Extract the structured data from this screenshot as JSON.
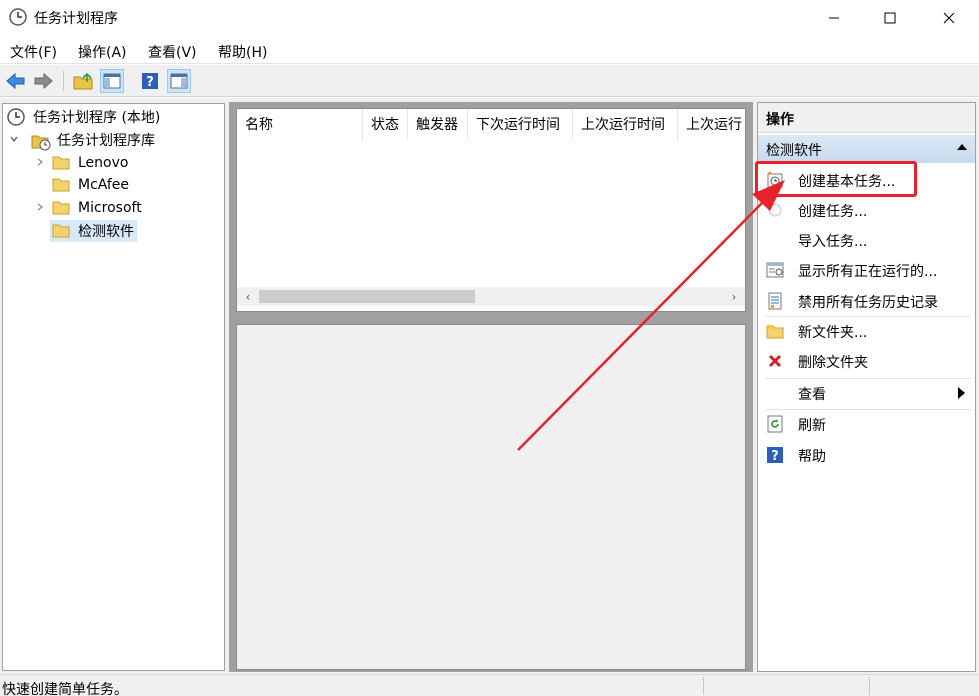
{
  "window": {
    "title": "任务计划程序",
    "controls": {
      "minimize": "minimize",
      "maximize": "maximize",
      "close": "close"
    }
  },
  "menu": {
    "items": [
      "文件(F)",
      "操作(A)",
      "查看(V)",
      "帮助(H)"
    ]
  },
  "toolbar": {
    "buttons": [
      "back-icon",
      "forward-icon",
      "folder-up-icon",
      "show-hide-console-tree-icon",
      "help-icon",
      "show-hide-action-pane-icon"
    ]
  },
  "tree": {
    "root": "任务计划程序 (本地)",
    "library": "任务计划程序库",
    "folders": [
      {
        "label": "Lenovo",
        "expandable": true,
        "selected": false
      },
      {
        "label": "McAfee",
        "expandable": false,
        "selected": false
      },
      {
        "label": "Microsoft",
        "expandable": true,
        "selected": false
      },
      {
        "label": "检测软件",
        "expandable": false,
        "selected": true
      }
    ]
  },
  "task_list": {
    "columns": [
      "名称",
      "状态",
      "触发器",
      "下次运行时间",
      "上次运行时间",
      "上次运行"
    ]
  },
  "actions_pane": {
    "header": "操作",
    "group": "检测软件",
    "items": [
      {
        "label": "创建基本任务...",
        "icon": "create-basic-task-icon"
      },
      {
        "label": "创建任务...",
        "icon": "create-task-icon"
      },
      {
        "label": "导入任务...",
        "icon": ""
      },
      {
        "label": "显示所有正在运行的...",
        "icon": "running-tasks-icon"
      },
      {
        "label": "禁用所有任务历史记录",
        "icon": "history-icon"
      },
      {
        "label": "新文件夹...",
        "icon": "new-folder-icon"
      },
      {
        "label": "删除文件夹",
        "icon": "delete-icon"
      },
      {
        "label": "查看",
        "icon": ""
      },
      {
        "label": "刷新",
        "icon": "refresh-icon"
      },
      {
        "label": "帮助",
        "icon": "help-icon"
      }
    ]
  },
  "status": {
    "text": "快速创建简单任务。"
  },
  "colors": {
    "annotation_red": "#e8222a",
    "selection_blue": "#d9e8f7",
    "group_header_blue": "#c6d9ee"
  }
}
